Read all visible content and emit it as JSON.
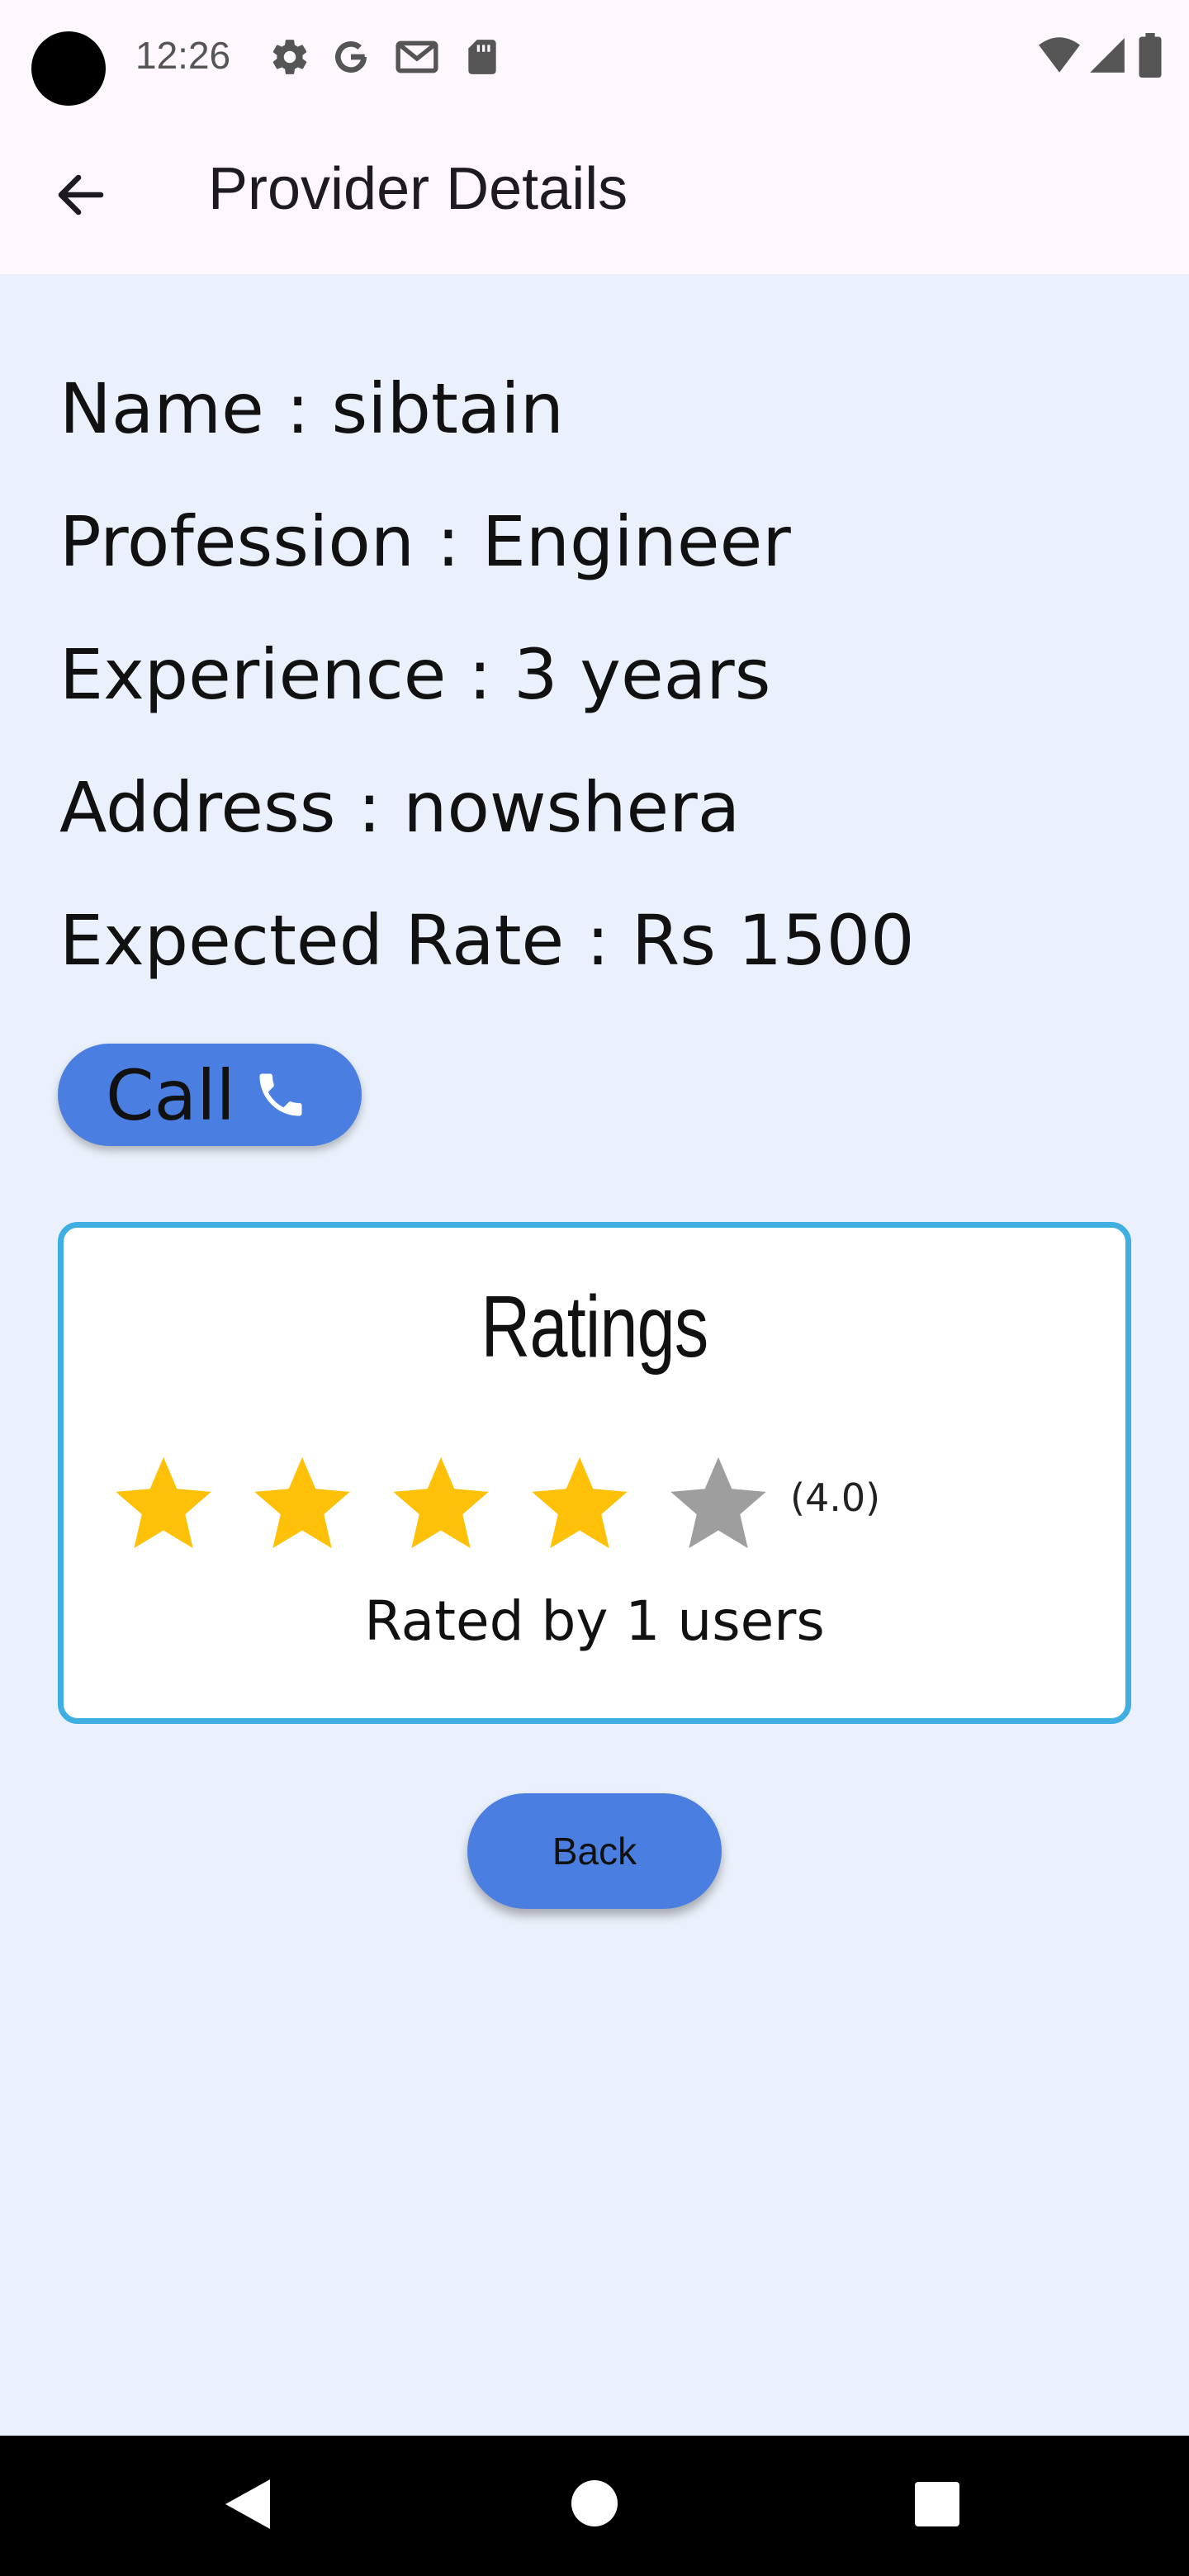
{
  "status_bar": {
    "time": "12:26",
    "left_icons": [
      "settings-icon",
      "google-icon",
      "gmail-icon",
      "sd-card-icon"
    ],
    "right_icons": [
      "wifi-icon",
      "cellular-signal-icon",
      "battery-icon"
    ]
  },
  "app_bar": {
    "title": "Provider Details",
    "back_icon": "arrow-left-icon"
  },
  "details": {
    "name": "Name : sibtain",
    "profession": "Profession : Engineer",
    "experience": "Experience : 3 years",
    "address": "Address : nowshera",
    "expected_rate": "Expected Rate : Rs 1500"
  },
  "call_button": {
    "label": "Call",
    "icon": "phone-icon"
  },
  "ratings": {
    "title": "Ratings",
    "stars_total": 5,
    "stars_filled": 4,
    "value_text": "(4.0)",
    "rated_by": "Rated by 1 users",
    "filled_color": "#FFC107",
    "empty_color": "#9E9E9E"
  },
  "back_button": {
    "label": "Back"
  },
  "nav_bar": {
    "icons": [
      "nav-back-icon",
      "nav-home-icon",
      "nav-recents-icon"
    ]
  },
  "colors": {
    "accent": "#4A7FE1",
    "card_border": "#3EAFE0",
    "background": "#EBF1FC"
  }
}
